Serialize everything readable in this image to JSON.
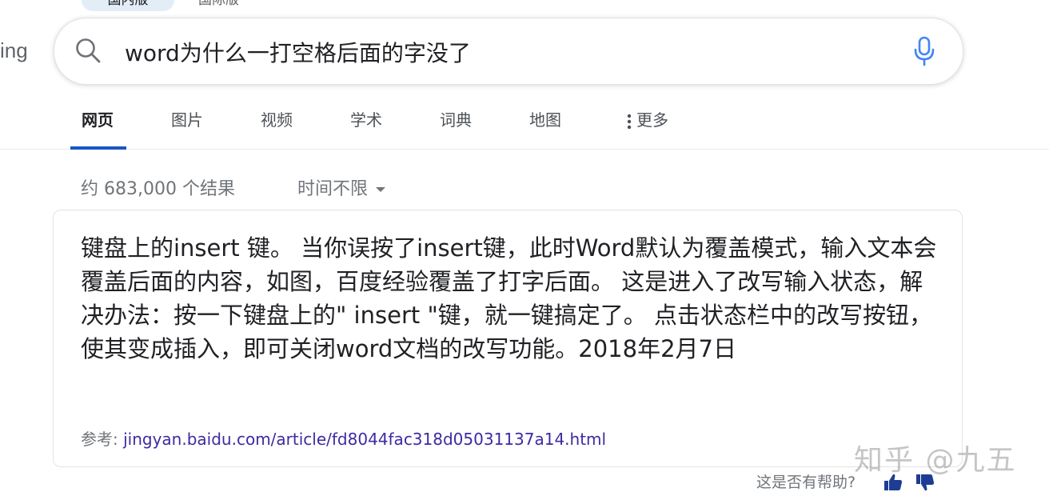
{
  "top_tabs": {
    "active": "国内版",
    "other": "国际版"
  },
  "logo_fragment": "ing",
  "search": {
    "query": "word为什么一打空格后面的字没了"
  },
  "nav": {
    "items": [
      "网页",
      "图片",
      "视频",
      "学术",
      "词典",
      "地图"
    ],
    "more": "更多",
    "active_index": 0
  },
  "results": {
    "count_text": "约 683,000 个结果",
    "time_filter": "时间不限"
  },
  "answer": {
    "snippet": "键盘上的insert 键。 当你误按了insert键，此时Word默认为覆盖模式，输入文本会覆盖后面的内容，如图，百度经验覆盖了打字后面。 这是进入了改写输入状态，解决办法：按一下键盘上的\" insert \"键，就一键搞定了。 点击状态栏中的改写按钮，使其变成插入，即可关闭word文档的改写功能。2018年2月7日",
    "reference_label": "参考: ",
    "reference_url": "jingyan.baidu.com/article/fd8044fac318d05031137a14.html"
  },
  "feedback": {
    "question": "这是否有帮助?"
  },
  "watermark": "知乎 @九五",
  "colors": {
    "accent": "#1a55c4",
    "link": "#3f2aa1",
    "mic": "#4285f4"
  }
}
